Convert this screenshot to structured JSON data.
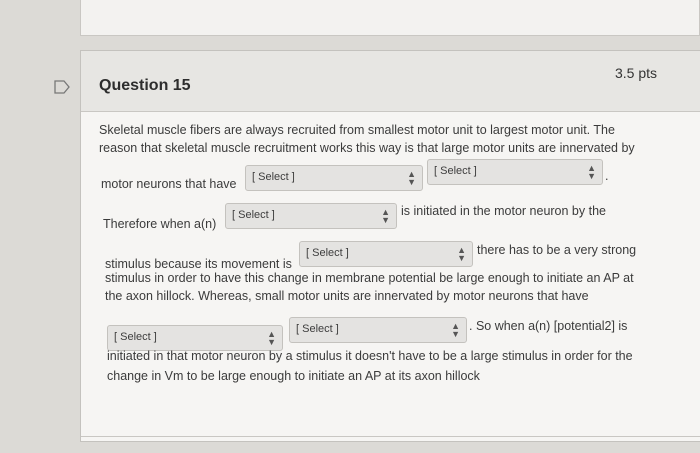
{
  "question": {
    "title": "Question 15",
    "points": "3.5 pts"
  },
  "text": {
    "line1": "Skeletal muscle fibers are always recruited from smallest motor unit to largest motor unit. The",
    "line2": "reason that skeletal muscle recruitment works this way is that large motor units are innervated by",
    "line3a": "motor neurons that have",
    "line3b": ".",
    "line4a": "Therefore when a(n)",
    "line4b": "is initiated in the motor neuron by the",
    "line5a": "stimulus because its movement is",
    "line5b": "there has to be a very strong",
    "line6": "stimulus in order to have this change in membrane potential be large enough to initiate an AP at",
    "line7": "the axon hillock. Whereas, small motor units are innervated by motor neurons that have",
    "line8b": ". So when a(n) [potential2] is",
    "line9": "initiated in that motor neuron by a stimulus it doesn't have to be a large stimulus in order for the",
    "line10": "change in Vm to be large enough to initiate an AP at its axon hillock"
  },
  "selects": {
    "s1": "[ Select ]",
    "s2": "[ Select ]",
    "s3": "[ Select ]",
    "s4": "[ Select ]",
    "s5": "[ Select ]",
    "s6": "[ Select ]"
  }
}
